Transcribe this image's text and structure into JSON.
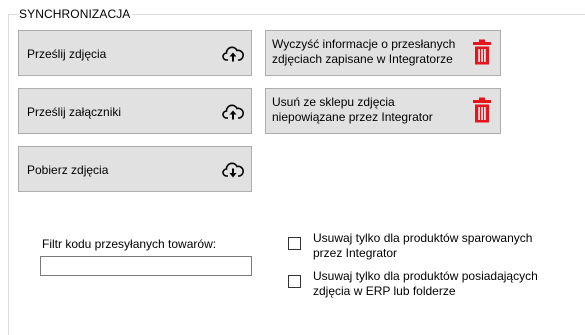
{
  "section": {
    "title": "SYNCHRONIZACJA"
  },
  "buttons": {
    "upload_photos": {
      "label": "Prześlij zdjęcia",
      "icon": "cloud-upload-icon"
    },
    "upload_attachments": {
      "label": "Prześlij załączniki",
      "icon": "cloud-upload-icon"
    },
    "download_photos": {
      "label": "Pobierz zdjęcia",
      "icon": "cloud-download-icon"
    },
    "clear_sent_info": {
      "line1": "Wyczyść informacje o przesłanych",
      "line2": "zdjęciach zapisane w Integratorze",
      "icon": "trash-icon"
    },
    "remove_unlinked": {
      "line1": "Usuń ze sklepu zdjęcia",
      "line2": "niepowiązane przez Integrator",
      "icon": "trash-icon"
    }
  },
  "filter": {
    "label": "Filtr kodu przesyłanych towarów:",
    "value": ""
  },
  "checkboxes": [
    {
      "line1": "Usuwaj tylko dla produktów sparowanych",
      "line2": "przez Integrator",
      "checked": false
    },
    {
      "line1": "Usuwaj tylko dla produktów posiadających",
      "line2": "zdjęcia w ERP lub folderze",
      "checked": false
    }
  ],
  "colors": {
    "button_bg": "#e1e1e1",
    "button_border": "#adadad",
    "trash_red": "#e8141c"
  }
}
